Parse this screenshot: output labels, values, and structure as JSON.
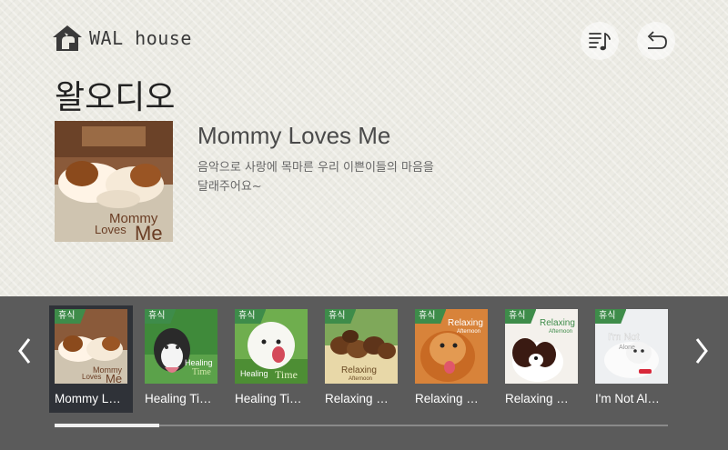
{
  "brand": {
    "name": "WAL house"
  },
  "header": {
    "title": "왈오디오"
  },
  "now_playing": {
    "title": "Mommy Loves Me",
    "description": "음악으로 사랑에 목마른 우리 이쁜이들의 마음을 달래주어요~",
    "cover_text": [
      "Mommy",
      "Loves",
      "Me"
    ]
  },
  "actions": {
    "playlist_icon": "playlist-music-icon",
    "back_icon": "undo-arrow-icon"
  },
  "carousel": {
    "tag_label": "휴식",
    "items": [
      {
        "label": "Mommy L…",
        "art": "mommy",
        "selected": true
      },
      {
        "label": "Healing Ti…",
        "art": "husky",
        "selected": false
      },
      {
        "label": "Healing Ti…",
        "art": "puppy",
        "selected": false
      },
      {
        "label": "Relaxing …",
        "art": "pups",
        "selected": false
      },
      {
        "label": "Relaxing …",
        "art": "pom",
        "selected": false
      },
      {
        "label": "Relaxing …",
        "art": "spaniel",
        "selected": false
      },
      {
        "label": "I'm Not Al…",
        "art": "white",
        "selected": false
      }
    ],
    "overlay_texts": {
      "husky": [
        "Healing",
        "Time"
      ],
      "puppy": [
        "Healing",
        "Time"
      ],
      "pups": [
        "Relaxing",
        "Afternoon"
      ],
      "pom": [
        "Relaxing",
        "Afternoon"
      ],
      "spaniel": [
        "Relaxing",
        "Afternoon"
      ],
      "white": [
        "I'm Not",
        "Alone"
      ]
    },
    "scroll_progress": 0.17
  },
  "colors": {
    "tag_green": "#3e8c4a",
    "bar_bg": "#5b5b5b",
    "selected_bg": "#2f3238"
  }
}
